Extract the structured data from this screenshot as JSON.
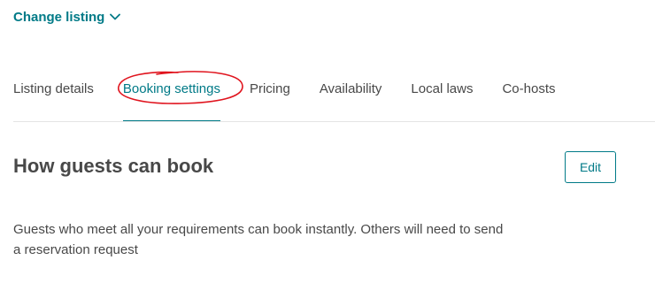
{
  "header": {
    "change_listing_label": "Change listing"
  },
  "tabs": [
    {
      "label": "Listing details",
      "active": false
    },
    {
      "label": "Booking settings",
      "active": true
    },
    {
      "label": "Pricing",
      "active": false
    },
    {
      "label": "Availability",
      "active": false
    },
    {
      "label": "Local laws",
      "active": false
    },
    {
      "label": "Co-hosts",
      "active": false
    }
  ],
  "section": {
    "title": "How guests can book",
    "edit_label": "Edit",
    "description": "Guests who meet all your requirements can book instantly. Others will need to send a reservation request"
  },
  "colors": {
    "accent": "#007a87",
    "text": "#484848",
    "annotation": "#e0141e",
    "divider": "#e4e4e4"
  },
  "icons": {
    "change_listing": "chevron-down-icon"
  },
  "annotation": {
    "shape": "hand-drawn-circle",
    "target": "Booking settings"
  }
}
